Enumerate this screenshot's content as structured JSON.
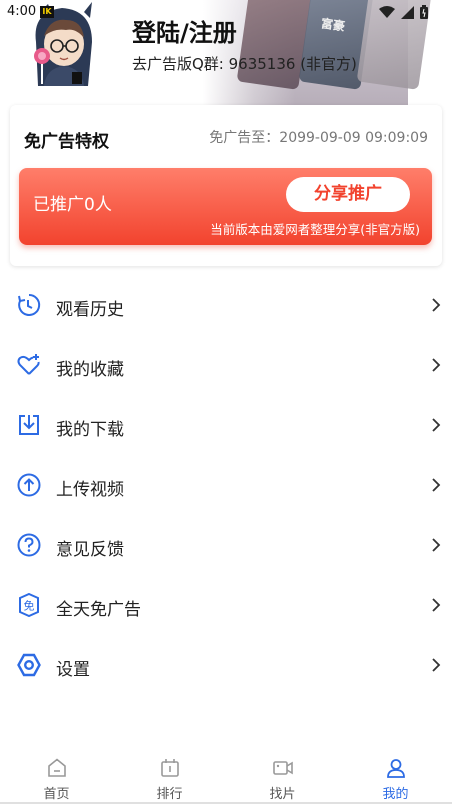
{
  "status_bar": {
    "time": "4:00",
    "badge": "IK"
  },
  "header": {
    "poster_text": "富豪",
    "login_title": "登陆/注册",
    "qq_group": "去广告版Q群: 9635136 (非官方)"
  },
  "privilege": {
    "title": "免广告特权",
    "expiry": "免广告至：2099-09-09 09:09:09",
    "promo_count": "已推广0人",
    "share_label": "分享推广",
    "note": "当前版本由爱网者整理分享(非官方版)"
  },
  "menu": [
    {
      "label": "观看历史",
      "icon": "history-icon"
    },
    {
      "label": "我的收藏",
      "icon": "heart-plus-icon"
    },
    {
      "label": "我的下载",
      "icon": "download-icon"
    },
    {
      "label": "上传视频",
      "icon": "upload-icon"
    },
    {
      "label": "意见反馈",
      "icon": "question-icon"
    },
    {
      "label": "全天免广告",
      "icon": "ad-free-icon"
    },
    {
      "label": "设置",
      "icon": "settings-icon"
    }
  ],
  "bottom_nav": [
    {
      "label": "首页",
      "icon": "home-icon",
      "active": false
    },
    {
      "label": "排行",
      "icon": "ranking-icon",
      "active": false
    },
    {
      "label": "找片",
      "icon": "video-icon",
      "active": false
    },
    {
      "label": "我的",
      "icon": "profile-icon",
      "active": true
    }
  ],
  "colors": {
    "accent": "#2d6be4",
    "promo_start": "#ff7e6a",
    "promo_end": "#f2432e"
  }
}
